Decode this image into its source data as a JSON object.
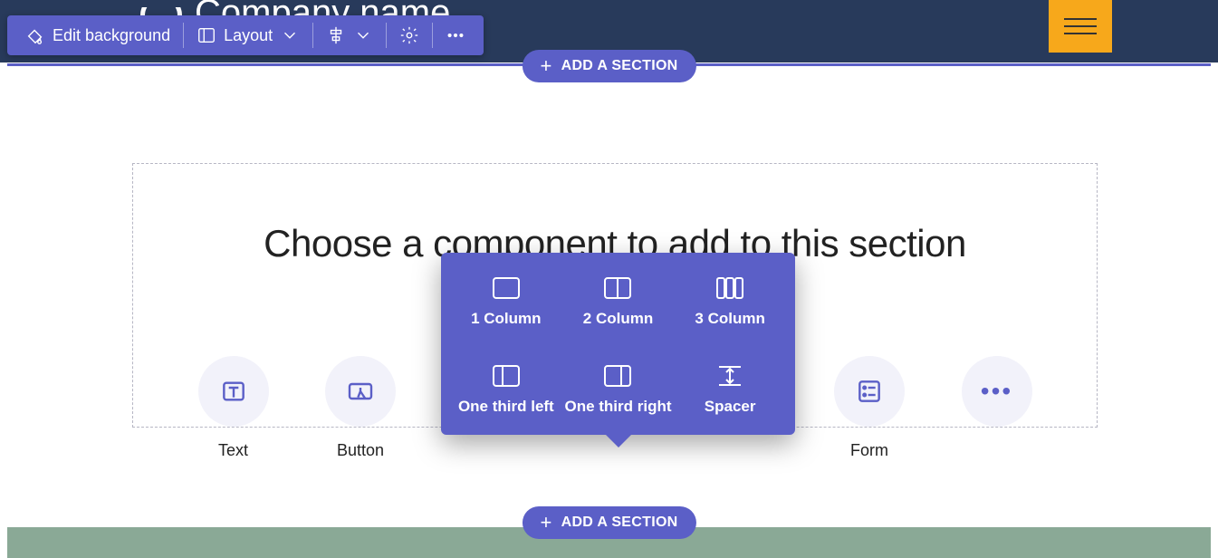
{
  "header": {
    "company_name": "Company name"
  },
  "toolbar": {
    "edit_background": "Edit background",
    "layout": "Layout"
  },
  "add_section_label": "ADD A SECTION",
  "section": {
    "title": "Choose a component to add to this section",
    "components": {
      "text": "Text",
      "button": "Button",
      "form": "Form"
    }
  },
  "layout_popover": {
    "col1": "1 Column",
    "col2": "2 Column",
    "col3": "3 Column",
    "third_left": "One third left",
    "third_right": "One third right",
    "spacer": "Spacer"
  }
}
